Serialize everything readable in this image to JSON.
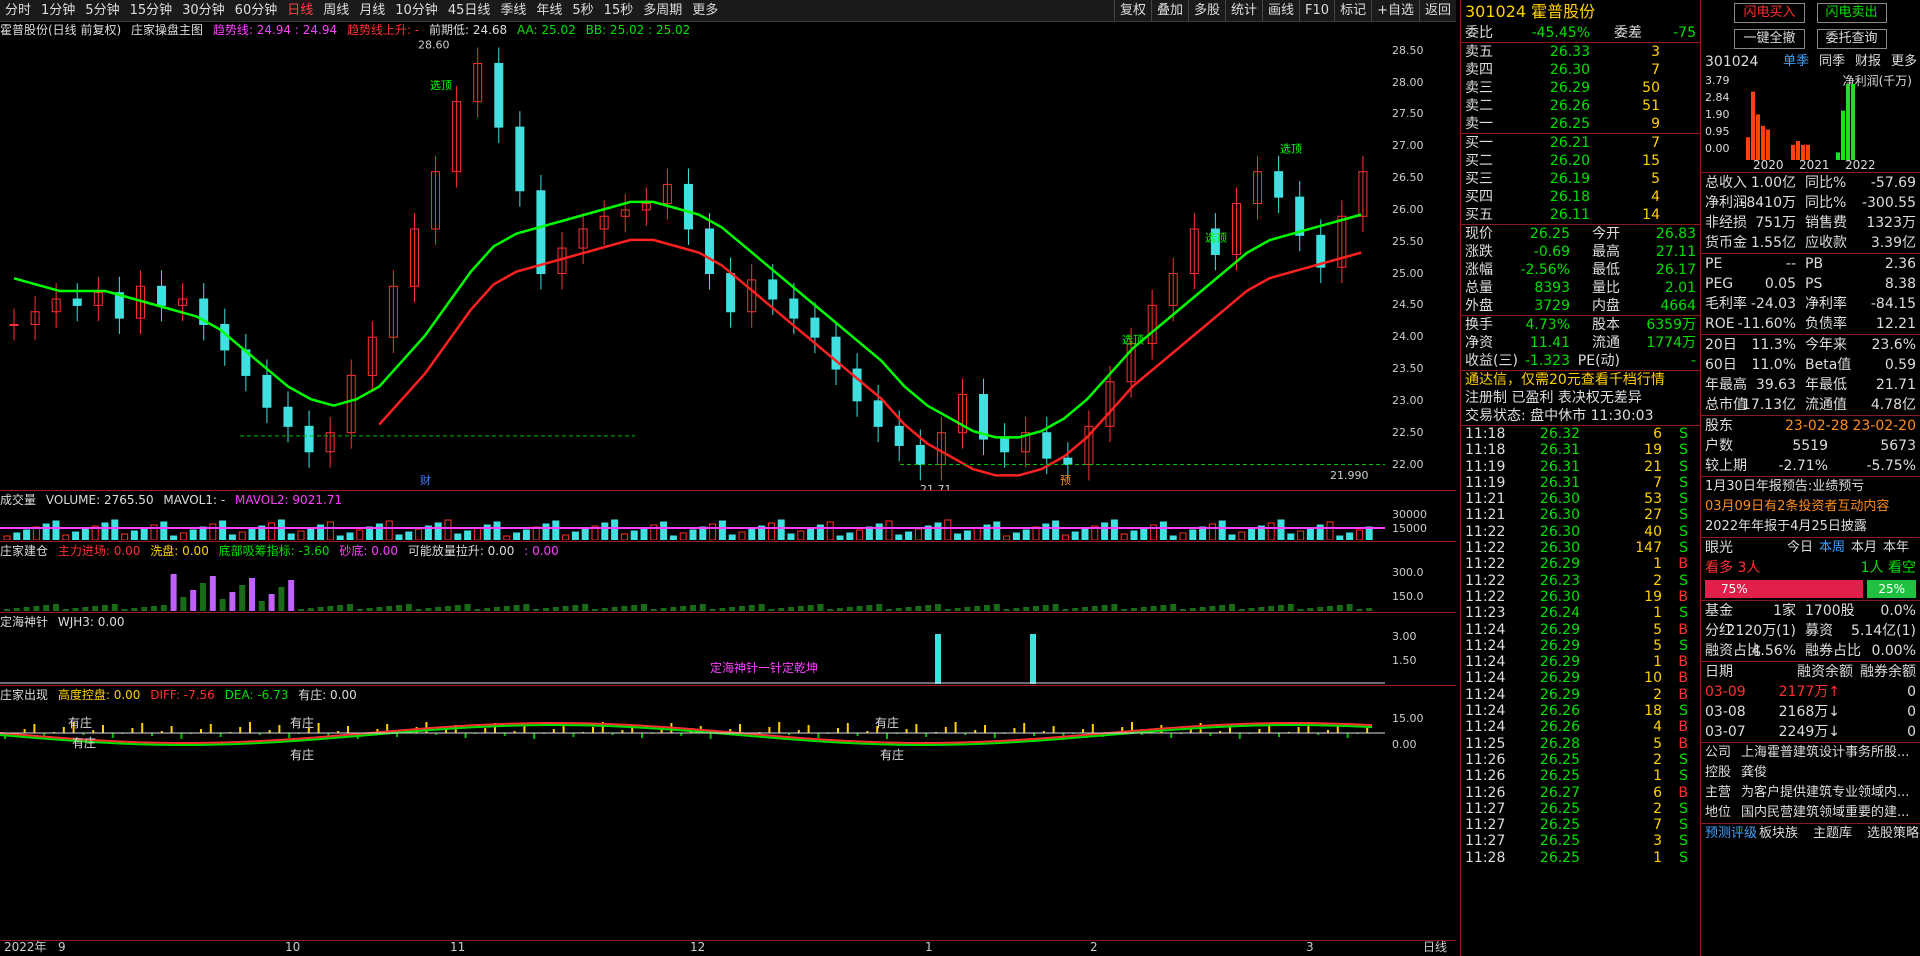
{
  "toolbar": {
    "items": [
      "分时",
      "1分钟",
      "5分钟",
      "15分钟",
      "30分钟",
      "60分钟",
      "日线",
      "周线",
      "月线",
      "10分钟",
      "45日线",
      "季线",
      "年线",
      "5秒",
      "15秒",
      "多周期",
      "更多"
    ],
    "selected": "日线",
    "right": [
      "复权",
      "叠加",
      "多股",
      "统计",
      "画线",
      "F10",
      "标记",
      "+自选",
      "返回"
    ]
  },
  "main_title": {
    "stock": "霍普股份(日线 前复权)",
    "indicator": "庄家操盘主图",
    "trend": "趋势线: 24.94 : 24.94",
    "trend_up": "趋势线上升: -",
    "prev_low": "前期低: 24.68",
    "aa": "AA: 25.02",
    "bb": "BB: 25.02 : 25.02"
  },
  "price_axis": [
    "28.50",
    "28.00",
    "27.50",
    "27.00",
    "26.50",
    "26.00",
    "25.50",
    "25.00",
    "24.50",
    "24.00",
    "23.50",
    "23.00",
    "22.50",
    "22.00"
  ],
  "annotations": {
    "high": "28.60",
    "low": "21.71",
    "last": "21.990",
    "xuanding": "选顶",
    "cai": "财",
    "yu": "预"
  },
  "vol_title": {
    "name": "成交量",
    "volume": "VOLUME: 2765.50",
    "mavol1": "MAVOL1: -",
    "mavol2": "MAVOL2: 9021.71"
  },
  "vol_axis": [
    "30000",
    "15000"
  ],
  "zj_title": {
    "name": "庄家建仓",
    "a": "主力进场: 0.00",
    "b": "洗盘: 0.00",
    "c": "底部吸筹指标: -3.60",
    "d": "砂底: 0.00",
    "e": "可能放量拉升: 0.00",
    "f": ": 0.00"
  },
  "zj_axis": [
    "300.0",
    "150.0"
  ],
  "dh_title": {
    "name": "定海神针",
    "val": "WJH3: 0.00",
    "label": "定海神针一针定乾坤"
  },
  "dh_axis": [
    "3.00",
    "1.50"
  ],
  "cx_title": {
    "name": "庄家出现",
    "a": "高度控盘: 0.00",
    "b": "DIFF: -7.56",
    "c": "DEA: -6.73",
    "d": "有庄: 0.00",
    "youzhuang": "有庄"
  },
  "cx_axis": [
    "15.00",
    "0.00"
  ],
  "date_axis": {
    "year": "2022年",
    "months": [
      "9",
      "10",
      "11",
      "12",
      "1",
      "2",
      "3"
    ],
    "period": "日线"
  },
  "chart_data": {
    "type": "line",
    "title": "",
    "xlabel": "",
    "ylabel": "",
    "ylim": [
      21.6,
      28.7
    ],
    "series": [
      {
        "name": "K",
        "values": [
          24.2,
          24.4,
          24.6,
          24.5,
          24.7,
          24.3,
          24.8,
          24.5,
          24.6,
          24.2,
          23.8,
          23.4,
          22.9,
          22.6,
          22.2,
          22.5,
          23.4,
          24.0,
          24.8,
          25.7,
          26.6,
          27.7,
          28.3,
          27.3,
          26.3,
          25.0,
          25.4,
          25.7,
          25.9,
          26.0,
          26.1,
          26.4,
          25.7,
          25.0,
          24.4,
          24.9,
          24.6,
          24.3,
          24.0,
          23.5,
          23.0,
          22.6,
          22.3,
          22.0,
          22.5,
          23.1,
          22.4,
          22.2,
          22.5,
          22.1,
          22.0,
          22.6,
          23.3,
          23.9,
          24.5,
          25.0,
          25.7,
          25.3,
          26.1,
          26.6,
          26.2,
          25.6,
          25.1,
          25.9,
          26.6
        ]
      },
      {
        "name": "MA",
        "values": [
          24.8,
          24.7,
          24.6,
          24.6,
          24.6,
          24.5,
          24.4,
          24.3,
          24.2,
          24.0,
          23.7,
          23.4,
          23.1,
          22.9,
          22.8,
          22.9,
          23.1,
          23.5,
          23.9,
          24.4,
          24.9,
          25.3,
          25.5,
          25.6,
          25.7,
          25.8,
          25.9,
          26.0,
          26.0,
          25.9,
          25.8,
          25.6,
          25.3,
          25.0,
          24.7,
          24.4,
          24.1,
          23.8,
          23.5,
          23.1,
          22.8,
          22.6,
          22.4,
          22.3,
          22.3,
          22.4,
          22.6,
          22.9,
          23.3,
          23.7,
          24.0,
          24.3,
          24.6,
          24.9,
          25.2,
          25.4,
          25.5,
          25.6,
          25.7,
          25.8
        ]
      }
    ]
  },
  "quote": {
    "code": "301024",
    "name": "霍普股份",
    "wb_label": "委比",
    "wb": "-45.45%",
    "wc_label": "委差",
    "wc": "-75",
    "sells": [
      [
        "卖五",
        "26.33",
        "3"
      ],
      [
        "卖四",
        "26.30",
        "7"
      ],
      [
        "卖三",
        "26.29",
        "50"
      ],
      [
        "卖二",
        "26.26",
        "51"
      ],
      [
        "卖一",
        "26.25",
        "9"
      ]
    ],
    "buys": [
      [
        "买一",
        "26.21",
        "7"
      ],
      [
        "买二",
        "26.20",
        "15"
      ],
      [
        "买三",
        "26.19",
        "5"
      ],
      [
        "买四",
        "26.18",
        "4"
      ],
      [
        "买五",
        "26.11",
        "14"
      ]
    ],
    "stats": [
      [
        "现价",
        "26.25",
        "今开",
        "26.83"
      ],
      [
        "涨跌",
        "-0.69",
        "最高",
        "27.11"
      ],
      [
        "涨幅",
        "-2.56%",
        "最低",
        "26.17"
      ],
      [
        "总量",
        "8393",
        "量比",
        "2.01"
      ],
      [
        "外盘",
        "3729",
        "内盘",
        "4664"
      ]
    ],
    "stats2": [
      [
        "换手",
        "4.73%",
        "股本",
        "6359万"
      ],
      [
        "净资",
        "11.41",
        "流通",
        "1774万"
      ],
      [
        "收益(三)",
        "-1.323",
        "PE(动)",
        "-"
      ]
    ],
    "notice": "通达信，仅需20元查看千档行情",
    "info": "注册制 已盈利 表决权无差异",
    "status": "交易状态: 盘中休市 11:30:03"
  },
  "ticks": [
    [
      "11:18",
      "26.32",
      "6",
      "S"
    ],
    [
      "11:18",
      "26.31",
      "19",
      "S"
    ],
    [
      "11:19",
      "26.31",
      "21",
      "S"
    ],
    [
      "11:19",
      "26.31",
      "7",
      "S"
    ],
    [
      "11:21",
      "26.30",
      "53",
      "S"
    ],
    [
      "11:21",
      "26.30",
      "27",
      "S"
    ],
    [
      "11:22",
      "26.30",
      "40",
      "S"
    ],
    [
      "11:22",
      "26.30",
      "147",
      "S"
    ],
    [
      "11:22",
      "26.29",
      "1",
      "B"
    ],
    [
      "11:22",
      "26.23",
      "2",
      "S"
    ],
    [
      "11:22",
      "26.30",
      "19",
      "B"
    ],
    [
      "11:23",
      "26.24",
      "1",
      "S"
    ],
    [
      "11:24",
      "26.29",
      "5",
      "B"
    ],
    [
      "11:24",
      "26.29",
      "5",
      "S"
    ],
    [
      "11:24",
      "26.29",
      "1",
      "B"
    ],
    [
      "11:24",
      "26.29",
      "10",
      "B"
    ],
    [
      "11:24",
      "26.29",
      "2",
      "B"
    ],
    [
      "11:24",
      "26.26",
      "18",
      "S"
    ],
    [
      "11:24",
      "26.26",
      "4",
      "B"
    ],
    [
      "11:25",
      "26.28",
      "5",
      "B"
    ],
    [
      "11:26",
      "26.25",
      "2",
      "S"
    ],
    [
      "11:26",
      "26.25",
      "1",
      "S"
    ],
    [
      "11:26",
      "26.27",
      "6",
      "B"
    ],
    [
      "11:27",
      "26.25",
      "2",
      "S"
    ],
    [
      "11:27",
      "26.25",
      "7",
      "S"
    ],
    [
      "11:27",
      "26.25",
      "3",
      "S"
    ],
    [
      "11:28",
      "26.25",
      "1",
      "S"
    ]
  ],
  "f10": {
    "btns": [
      "闪电买入",
      "闪电卖出",
      "一键全撤",
      "委托查询"
    ],
    "code": "301024",
    "tabs": [
      "单季",
      "同季",
      "财报",
      "更多"
    ],
    "chart_label": "净利润(千万)",
    "years": [
      "2020",
      "2021",
      "2022"
    ],
    "yvals": [
      "3.79",
      "2.84",
      "1.90",
      "0.95",
      "0.00"
    ],
    "rows1": [
      [
        "总收入",
        "1.00亿",
        "同比%",
        "-57.69"
      ],
      [
        "净利润",
        "-8410万",
        "同比%",
        "-300.55"
      ],
      [
        "非经损",
        "751万",
        "销售费",
        "1323万"
      ],
      [
        "货币金",
        "1.55亿",
        "应收款",
        "3.39亿"
      ]
    ],
    "rows2": [
      [
        "PE",
        "--",
        "PB",
        "2.36"
      ],
      [
        "PEG",
        "0.05",
        "PS",
        "8.38"
      ],
      [
        "毛利率",
        "-24.03",
        "净利率",
        "-84.15"
      ],
      [
        "ROE",
        "-11.60%",
        "负债率",
        "12.21"
      ]
    ],
    "rows3": [
      [
        "20日",
        "11.3%",
        "今年来",
        "23.6%"
      ],
      [
        "60日",
        "11.0%",
        "Beta值",
        "0.59"
      ],
      [
        "年最高",
        "39.63",
        "年最低",
        "21.71"
      ],
      [
        "总市值",
        "17.13亿",
        "流通值",
        "4.78亿"
      ]
    ],
    "holders": {
      "label": "股东",
      "d1": "23-02-28",
      "d2": "23-02-20",
      "rows": [
        [
          "户数",
          "5519",
          "5673"
        ],
        [
          "较上期",
          "-2.71%",
          "-5.75%"
        ]
      ]
    },
    "news": [
      "1月30日年报预告:业绩预亏",
      "03月09日有2条投资者互动内容",
      "2022年年报于4月25日披露"
    ],
    "eyes": {
      "label": "眼光",
      "tabs": [
        "今日",
        "本周",
        "本月",
        "本年"
      ],
      "bull": "看多",
      "bull_n": "3人",
      "bear_n": "1人",
      "bear": "看空",
      "p1": "75%",
      "p2": "25%"
    },
    "fund": [
      [
        "基金",
        "1家",
        "1700股",
        "0.0%"
      ],
      [
        "分红",
        "2120万(1)",
        "募资",
        "5.14亿(1)"
      ],
      [
        "融资占比",
        "4.56%",
        "融券占比",
        "0.00%"
      ]
    ],
    "margin_head": [
      "日期",
      "融资余额",
      "融券余额"
    ],
    "margin": [
      [
        "03-09",
        "2177万↑",
        "0"
      ],
      [
        "03-08",
        "2168万↓",
        "0"
      ],
      [
        "03-07",
        "2249万↓",
        "0"
      ]
    ],
    "company": [
      [
        "公司",
        "上海霍普建筑设计事务所股..."
      ],
      [
        "控股",
        "龚俊"
      ],
      [
        "主营",
        "为客户提供建筑专业领域内..."
      ],
      [
        "地位",
        "国内民营建筑领域重要的建..."
      ]
    ],
    "bottom": [
      "预测评级",
      "板块族",
      "主题库",
      "选股策略"
    ]
  }
}
